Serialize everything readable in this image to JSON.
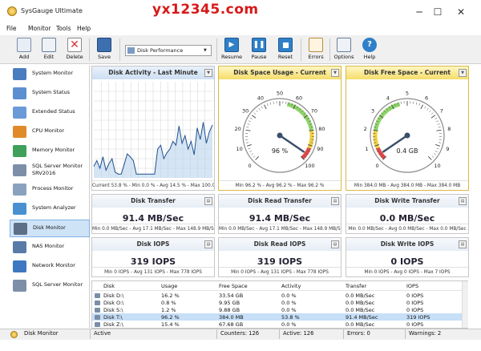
{
  "app": {
    "title": "SysGauge Ultimate",
    "watermark": "yx12345.com"
  },
  "window_controls": {
    "minimize": "─",
    "maximize": "☐",
    "close": "✕"
  },
  "menu": [
    "File",
    "Monitor",
    "Tools",
    "Help"
  ],
  "toolbar": {
    "add": "Add",
    "edit": "Edit",
    "delete": "Delete",
    "save": "Save",
    "combo_value": "Disk Performance",
    "resume": "Resume",
    "pause": "Pause",
    "reset": "Reset",
    "errors": "Errors",
    "options": "Options",
    "help": "Help"
  },
  "sidebar": {
    "items": [
      {
        "label": "System Monitor",
        "icon": "computer-icon"
      },
      {
        "label": "System Status",
        "icon": "status-icon"
      },
      {
        "label": "Extended Status",
        "icon": "extended-status-icon"
      },
      {
        "label": "CPU Monitor",
        "icon": "cpu-icon"
      },
      {
        "label": "Memory Monitor",
        "icon": "memory-icon"
      },
      {
        "label": "SQL Server Monitor",
        "label2": "SRV2016",
        "icon": "sql-server-icon"
      },
      {
        "label": "Process Monitor",
        "icon": "process-icon"
      },
      {
        "label": "System Analyzer",
        "icon": "analyzer-icon"
      },
      {
        "label": "Disk Monitor",
        "icon": "disk-icon",
        "selected": true
      },
      {
        "label": "NAS Monitor",
        "icon": "nas-icon"
      },
      {
        "label": "Network Monitor",
        "icon": "network-icon"
      },
      {
        "label": "SQL Server Monitor",
        "icon": "sql-server-icon"
      }
    ]
  },
  "panels": {
    "activity": {
      "title": "Disk Activity - Last Minute",
      "footer": "Current 53.8 % - Min 0.0 % - Avg 14.5 % - Max 100.0 %",
      "values": [
        12,
        18,
        10,
        22,
        8,
        15,
        20,
        6,
        4,
        4,
        14,
        25,
        22,
        18,
        4,
        4,
        4,
        4,
        4,
        4,
        4,
        30,
        34,
        20,
        26,
        30,
        38,
        34,
        54,
        36,
        44,
        30,
        38,
        24,
        52,
        40,
        58,
        36,
        48,
        55
      ]
    },
    "usage": {
      "title": "Disk Space Usage - Current",
      "value": "96 %",
      "value_num": 96,
      "footer": "Min 96.2 % - Avg 96.2 % - Max 96.2 %",
      "ticks": [
        "0",
        "10",
        "20",
        "30",
        "40",
        "50",
        "60",
        "70",
        "80",
        "90",
        "100"
      ]
    },
    "free": {
      "title": "Disk Free Space - Current",
      "value": "0.4 GB",
      "value_num": 0.4,
      "footer": "Min 384.0 MB - Avg 384.0 MB - Max 384.0 MB",
      "ticks": [
        "0",
        "1",
        "2",
        "3",
        "4",
        "5",
        "6",
        "7",
        "8",
        "9",
        "10"
      ]
    },
    "transfer": {
      "title": "Disk Transfer",
      "value": "91.4 MB/Sec",
      "footer": "Min 0.0 MB/Sec - Avg 17.1 MB/Sec - Max 148.9 MB/Sec"
    },
    "read_transfer": {
      "title": "Disk Read Transfer",
      "value": "91.4 MB/Sec",
      "footer": "Min 0.0 MB/Sec - Avg 17.1 MB/Sec - Max 148.9 MB/Sec"
    },
    "write_transfer": {
      "title": "Disk Write Transfer",
      "value": "0.0 MB/Sec",
      "footer": "Min 0.0 MB/Sec - Avg 0.0 MB/Sec - Max 0.0 MB/Sec"
    },
    "iops": {
      "title": "Disk IOPS",
      "value": "319 IOPS",
      "footer": "Min 0 IOPS - Avg 131 IOPS - Max 778 IOPS"
    },
    "read_iops": {
      "title": "Disk Read IOPS",
      "value": "319 IOPS",
      "footer": "Min 0 IOPS - Avg 131 IOPS - Max 778 IOPS"
    },
    "write_iops": {
      "title": "Disk Write IOPS",
      "value": "0 IOPS",
      "footer": "Min 0 IOPS - Avg 0 IOPS - Max 7 IOPS"
    }
  },
  "table": {
    "headers": [
      "Disk",
      "Usage",
      "Free Space",
      "Activity",
      "Transfer",
      "IOPS"
    ],
    "rows": [
      [
        "Disk D:\\",
        "16.2 %",
        "33.54 GB",
        "0.0 %",
        "0.0 MB/Sec",
        "0 IOPS"
      ],
      [
        "Disk O:\\",
        "0.8 %",
        "9.95 GB",
        "0.0 %",
        "0.0 MB/Sec",
        "0 IOPS"
      ],
      [
        "Disk S:\\",
        "1.2 %",
        "9.88 GB",
        "0.0 %",
        "0.0 MB/Sec",
        "0 IOPS"
      ],
      [
        "Disk T:\\",
        "96.2 %",
        "384.0 MB",
        "53.8 %",
        "91.4 MB/Sec",
        "319 IOPS"
      ],
      [
        "Disk Z:\\",
        "15.4 %",
        "67.68 GB",
        "0.0 %",
        "0.0 MB/Sec",
        "0 IOPS"
      ]
    ]
  },
  "status": {
    "monitor": "Disk Monitor",
    "state": "Active",
    "counters": "Counters: 126",
    "active": "Active: 126",
    "errors": "Errors: 0",
    "warnings": "Warnings: 2"
  }
}
